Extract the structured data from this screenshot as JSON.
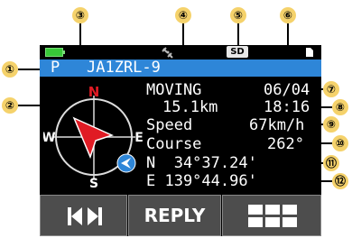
{
  "callouts": [
    "①",
    "②",
    "③",
    "④",
    "⑤",
    "⑥",
    "⑦",
    "⑧",
    "⑨",
    "⑩",
    "⑪",
    "⑫"
  ],
  "status_bar": {
    "battery_icon": "battery-icon",
    "gps_icon": "satellite-icon",
    "sd_label": "SD",
    "memo_icon": "document-icon"
  },
  "station": {
    "prefix": "P",
    "callsign": "JA1ZRL-9"
  },
  "compass": {
    "north": "N",
    "south": "S",
    "east": "E",
    "west": "W",
    "heading_deg": 315
  },
  "info": {
    "status": "MOVING",
    "date": "06/04",
    "distance": "15.1km",
    "time": "18:16",
    "speed_label": "Speed",
    "speed_value": "67km/h",
    "course_label": "Course",
    "course_value": "262°",
    "lat": "N  34°37.24'",
    "lon": "E 139°44.96'"
  },
  "softkeys": {
    "reply_label": "REPLY"
  },
  "colors": {
    "title_bar": "#2e86d8",
    "marker": "#f5d26b",
    "needle": "#e01b24",
    "direction_red": "#e01b24"
  }
}
